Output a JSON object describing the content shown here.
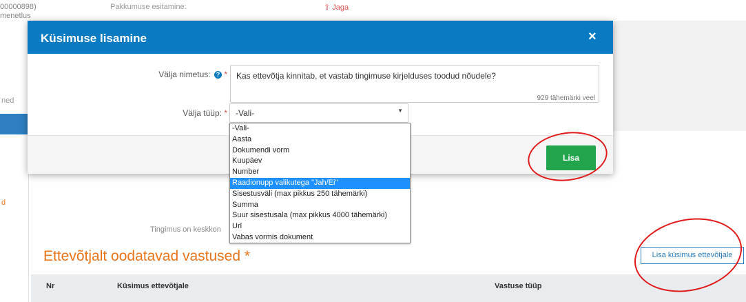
{
  "background": {
    "top_left_line1": "00000898)",
    "top_left_line2": "menetlus",
    "top_mid_line1": "Pakkumuse esitamine:",
    "top_share": "Jaga",
    "left_text_top": "ned",
    "left_text_bottom": "d",
    "condition_text": "Tingimus on keskkon",
    "section_heading": "Ettevõtjalt oodatavad vastused *",
    "add_question_button": "Lisa küsimus ettevõtjale",
    "table_headers": [
      "Nr",
      "Küsimus ettevõtjale",
      "Vastuse tüüp"
    ]
  },
  "modal": {
    "title": "Küsimuse lisamine",
    "close_label": "×",
    "field_name_label": "Välja nimetus:",
    "field_name_value": "Kas ettevõtja kinnitab, et vastab tingimuse kirjelduses toodud nõudele?",
    "char_count": "929 tähemärki veel",
    "field_type_label": "Välja tüüp:",
    "field_type_value": "-Vali-",
    "required_mark": "*",
    "help_icon": "?",
    "submit_label": "Lisa"
  },
  "dropdown": {
    "options": [
      "-Vali-",
      "Aasta",
      "Dokumendi vorm",
      "Kuupäev",
      "Number",
      "Raadionupp valikutega \"Jah/Ei\"",
      "Sisestusväli (max pikkus 250 tähemärki)",
      "Summa",
      "Suur sisestusala (max pikkus 4000 tähemärki)",
      "Url",
      "Vabas vormis dokument"
    ],
    "highlighted_index": 5
  },
  "colors": {
    "header_blue": "#0a7bc2",
    "accent_orange": "#e8741b",
    "submit_green": "#21a44c",
    "annotation_red": "#e01b1b"
  }
}
